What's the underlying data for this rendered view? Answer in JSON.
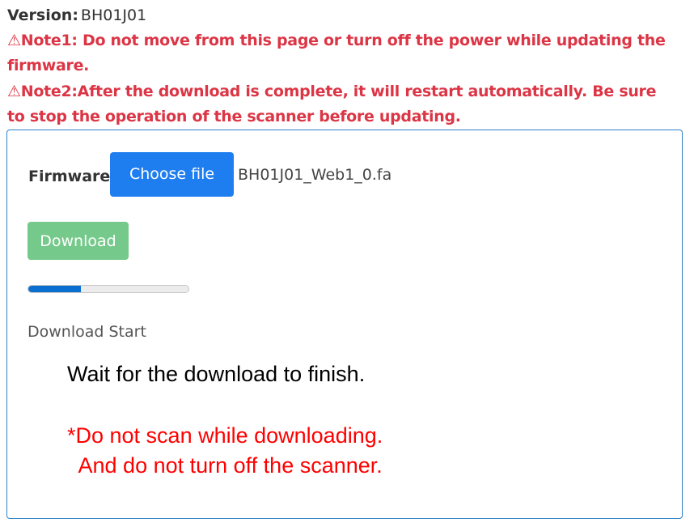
{
  "header": {
    "version_label": "Version:",
    "version_value": "BH01J01",
    "warning_icon": "⚠",
    "note1": "Note1: Do not move from this page or turn off the power while updating the firmware.",
    "note2": "Note2:After the download is complete, it will restart automatically. Be sure to stop the operation of the scanner before updating."
  },
  "form": {
    "firmware_label": "Firmware:",
    "choose_file_label": "Choose file",
    "file_name": "BH01J01_Web1_0.fa",
    "download_label": "Download",
    "progress_percent": 33,
    "status": "Download Start",
    "wait_message": "Wait for the download to finish.",
    "warning_message": "*Do not scan while downloading.\n  And do not turn off the scanner."
  },
  "colors": {
    "note_red": "#dc3545",
    "primary_blue": "#1e7ef0",
    "download_green": "#75c98a",
    "progress_blue": "#0b6fd0",
    "warning_red": "#ff0000"
  }
}
